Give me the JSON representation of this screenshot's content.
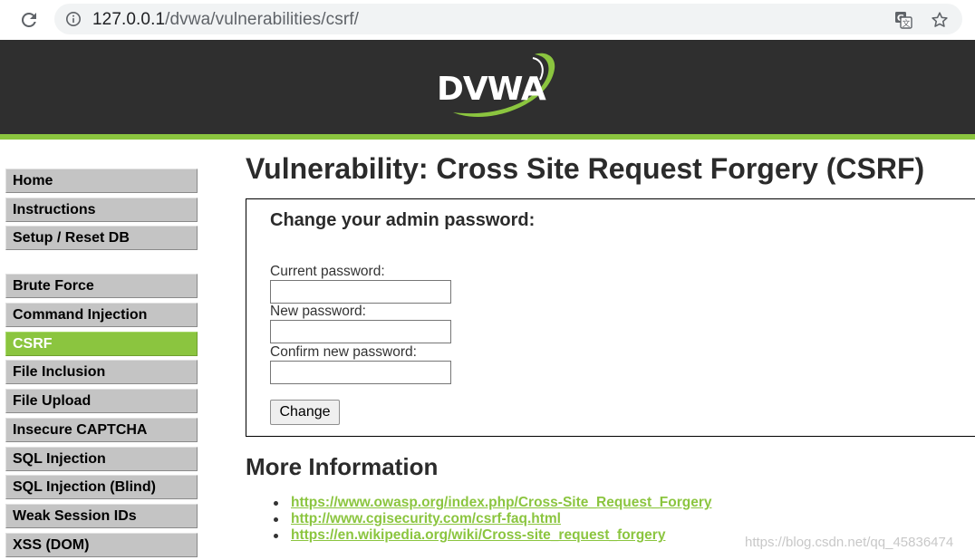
{
  "browser": {
    "url_host": "127.0.0.1",
    "url_path": "/dvwa/vulnerabilities/csrf/",
    "icons": [
      "reload-icon",
      "site-info-icon",
      "translate-icon",
      "bookmark-star-icon"
    ]
  },
  "header": {
    "logo_text": "DVWA",
    "colors": {
      "header_bg": "#2f2f2f",
      "accent": "#8bc53f"
    }
  },
  "sidebar": {
    "items": [
      {
        "label": "Home"
      },
      {
        "label": "Instructions"
      },
      {
        "label": "Setup / Reset DB"
      },
      {
        "label": "Brute Force"
      },
      {
        "label": "Command Injection"
      },
      {
        "label": "CSRF",
        "selected": true
      },
      {
        "label": "File Inclusion"
      },
      {
        "label": "File Upload"
      },
      {
        "label": "Insecure CAPTCHA"
      },
      {
        "label": "SQL Injection"
      },
      {
        "label": "SQL Injection (Blind)"
      },
      {
        "label": "Weak Session IDs"
      },
      {
        "label": "XSS (DOM)"
      }
    ]
  },
  "main": {
    "title": "Vulnerability: Cross Site Request Forgery (CSRF)",
    "form": {
      "heading": "Change your admin password:",
      "current_label": "Current password:",
      "current_value": "",
      "new_label": "New password:",
      "new_value": "",
      "confirm_label": "Confirm new password:",
      "confirm_value": "",
      "submit_label": "Change"
    },
    "more_info": {
      "heading": "More Information",
      "links": [
        "https://www.owasp.org/index.php/Cross-Site_Request_Forgery",
        "http://www.cgisecurity.com/csrf-faq.html",
        "https://en.wikipedia.org/wiki/Cross-site_request_forgery"
      ]
    }
  },
  "watermark": "https://blog.csdn.net/qq_45836474"
}
